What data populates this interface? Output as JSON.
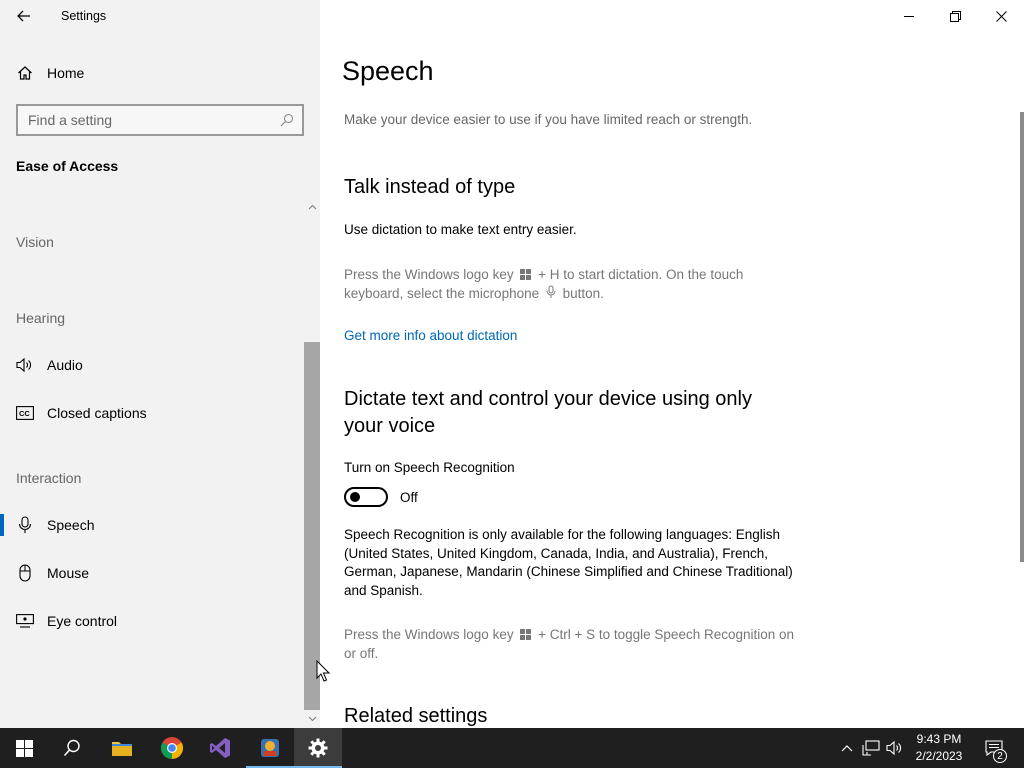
{
  "window": {
    "title": "Settings",
    "controls": {
      "minimize": "minimize-icon",
      "restore": "restore-icon",
      "close": "close-icon"
    }
  },
  "sidebar": {
    "home_label": "Home",
    "search_placeholder": "Find a setting",
    "section_title": "Ease of Access",
    "groups": [
      {
        "label": "Vision",
        "items": []
      },
      {
        "label": "Hearing",
        "items": [
          {
            "label": "Audio",
            "icon": "speaker-icon"
          },
          {
            "label": "Closed captions",
            "icon": "closed-captions-icon"
          }
        ]
      },
      {
        "label": "Interaction",
        "items": [
          {
            "label": "Speech",
            "icon": "microphone-icon",
            "selected": true
          },
          {
            "label": "Mouse",
            "icon": "mouse-icon"
          },
          {
            "label": "Eye control",
            "icon": "eye-control-icon"
          }
        ]
      }
    ]
  },
  "main": {
    "title": "Speech",
    "subtitle": "Make your device easier to use if you have limited reach or strength.",
    "talk_section": {
      "heading": "Talk instead of type",
      "description": "Use dictation to make text entry easier.",
      "hint_part1": "Press the Windows logo key",
      "hint_part2": "+ H to start dictation.  On the touch keyboard, select the microphone",
      "hint_part3": "button.",
      "link": "Get more info about dictation"
    },
    "dictate_section": {
      "heading": "Dictate text and control your device using only your voice",
      "toggle_label": "Turn on Speech Recognition",
      "toggle_state": "Off",
      "toggle_on": false,
      "availability": "Speech Recognition is only available for the following languages: English (United States, United Kingdom, Canada, India, and Australia), French, German, Japanese, Mandarin (Chinese Simplified and Chinese Traditional) and Spanish.",
      "hint_part1": "Press the Windows logo key",
      "hint_part2": "+ Ctrl + S to toggle Speech Recognition on or off."
    },
    "related_heading": "Related settings"
  },
  "taskbar": {
    "apps": [
      "start-button",
      "search-button",
      "file-explorer",
      "chrome",
      "visual-studio",
      "app-icon",
      "settings"
    ],
    "time": "9:43 PM",
    "date": "2/2/2023",
    "notification_count": "2",
    "accent": "#76b9ed"
  },
  "colors": {
    "accent": "#0067c0",
    "link": "#0067b8",
    "sidebar_bg": "#f2f2f2",
    "taskbar_bg": "#1f1f1f"
  }
}
